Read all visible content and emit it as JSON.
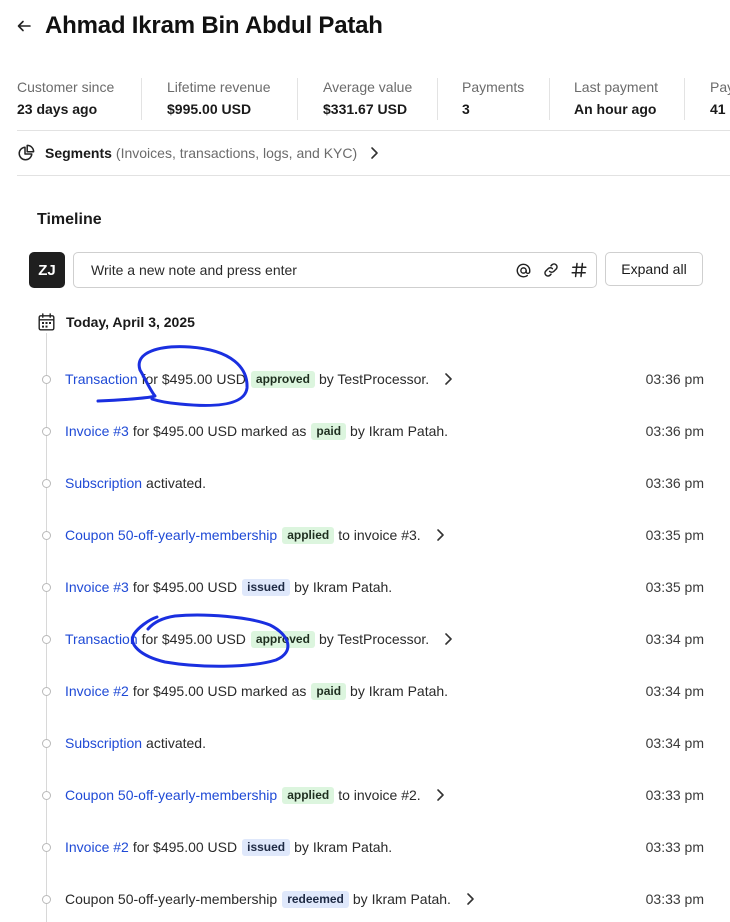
{
  "header": {
    "title": "Ahmad Ikram Bin Abdul Patah",
    "back_icon": "arrow-left-icon"
  },
  "stats": [
    {
      "label": "Customer since",
      "value": "23 days ago"
    },
    {
      "label": "Lifetime revenue",
      "value": "$995.00 USD"
    },
    {
      "label": "Average value",
      "value": "$331.67 USD"
    },
    {
      "label": "Payments",
      "value": "3"
    },
    {
      "label": "Last payment",
      "value": "An hour ago"
    },
    {
      "label": "Pay",
      "value": "41"
    }
  ],
  "segments": {
    "title": "Segments",
    "subtitle": "(Invoices, transactions, logs, and KYC)",
    "icon": "pie-chart-icon"
  },
  "timeline": {
    "heading": "Timeline",
    "avatar": "ZJ",
    "note_placeholder": "Write a new note and press enter",
    "expand_label": "Expand all",
    "date": "Today, April 3, 2025",
    "events": [
      {
        "link": "Transaction",
        "pre": "for $495.00 USD",
        "badge": "approved",
        "badge_color": "green",
        "post": "by TestProcessor.",
        "chevron": true,
        "time": "03:36 pm"
      },
      {
        "link": "Invoice #3",
        "pre": "for $495.00 USD marked as",
        "badge": "paid",
        "badge_color": "green",
        "post": "by Ikram Patah.",
        "chevron": false,
        "time": "03:36 pm"
      },
      {
        "link": "Subscription",
        "pre": "activated.",
        "badge": "",
        "badge_color": "",
        "post": "",
        "chevron": false,
        "time": "03:36 pm"
      },
      {
        "link": "Coupon 50-off-yearly-membership",
        "pre": "",
        "badge": "applied",
        "badge_color": "green",
        "post": "to invoice #3.",
        "chevron": true,
        "time": "03:35 pm"
      },
      {
        "link": "Invoice #3",
        "pre": "for $495.00 USD",
        "badge": "issued",
        "badge_color": "blue",
        "post": "by Ikram Patah.",
        "chevron": false,
        "time": "03:35 pm"
      },
      {
        "link": "Transaction",
        "pre": "for $495.00 USD",
        "badge": "approved",
        "badge_color": "green",
        "post": "by TestProcessor.",
        "chevron": true,
        "time": "03:34 pm"
      },
      {
        "link": "Invoice #2",
        "pre": "for $495.00 USD marked as",
        "badge": "paid",
        "badge_color": "green",
        "post": "by Ikram Patah.",
        "chevron": false,
        "time": "03:34 pm"
      },
      {
        "link": "Subscription",
        "pre": "activated.",
        "badge": "",
        "badge_color": "",
        "post": "",
        "chevron": false,
        "time": "03:34 pm"
      },
      {
        "link": "Coupon 50-off-yearly-membership",
        "pre": "",
        "badge": "applied",
        "badge_color": "green",
        "post": "to invoice #2.",
        "chevron": true,
        "time": "03:33 pm"
      },
      {
        "link": "Invoice #2",
        "pre": "for $495.00 USD",
        "badge": "issued",
        "badge_color": "blue",
        "post": "by Ikram Patah.",
        "chevron": false,
        "time": "03:33 pm"
      },
      {
        "link": "",
        "pre": "Coupon 50-off-yearly-membership",
        "badge": "redeemed",
        "badge_color": "blue",
        "post": "by Ikram Patah.",
        "chevron": true,
        "time": "03:33 pm"
      }
    ]
  },
  "colors": {
    "link": "#1f4ad6",
    "badge_green": "#dcf5de",
    "badge_blue": "#dfe8fb",
    "annotation": "#1a2fe0"
  }
}
